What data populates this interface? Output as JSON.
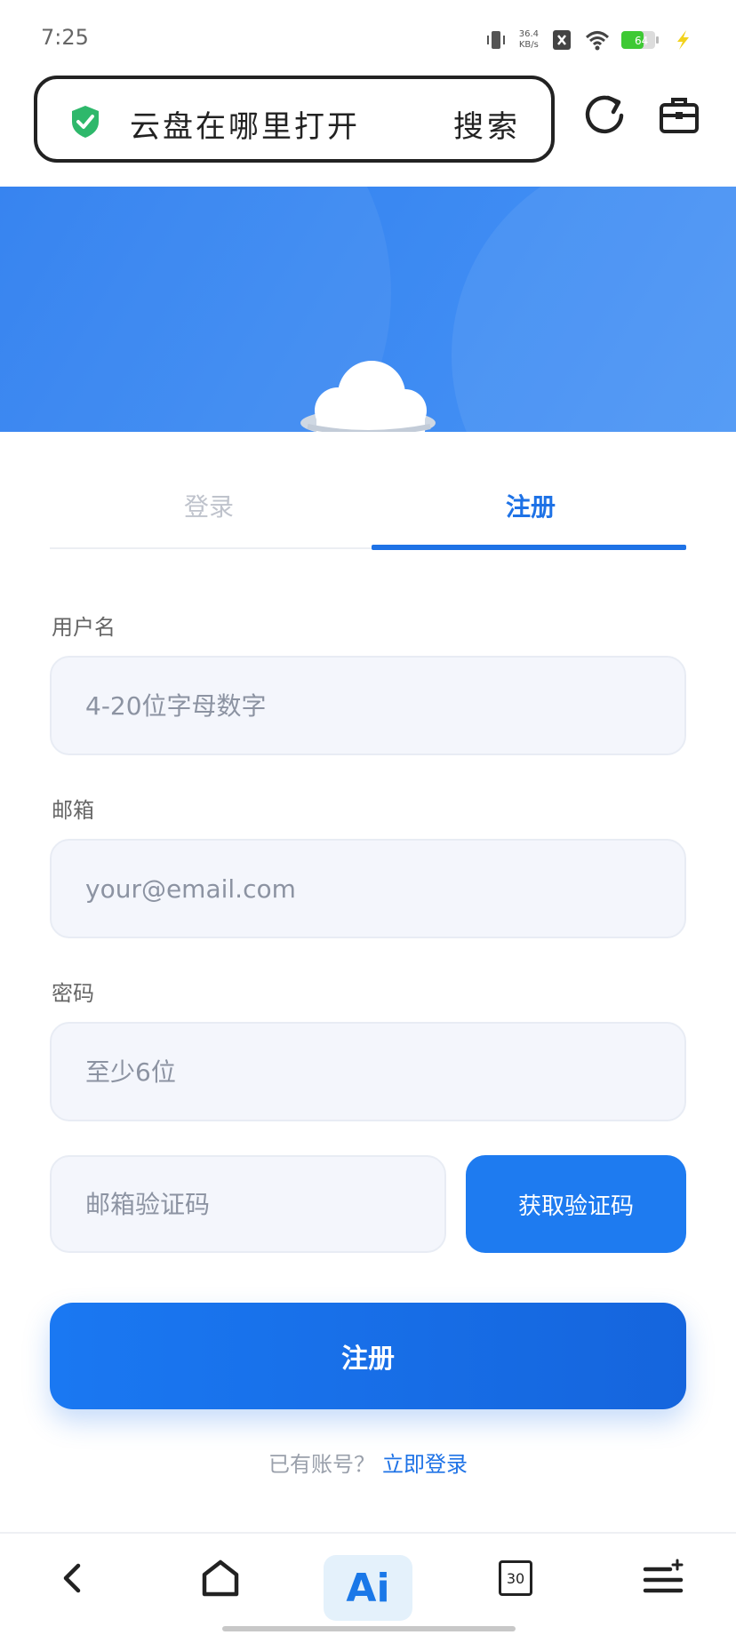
{
  "status_bar": {
    "time": "7:25",
    "net_speed_value": "36.4",
    "net_speed_unit": "KB/s",
    "battery": "64"
  },
  "browser": {
    "url_text": "云盘在哪里打开",
    "search_label": "搜索"
  },
  "tabs": {
    "login": "登录",
    "register": "注册",
    "active": "register"
  },
  "form": {
    "username": {
      "label": "用户名",
      "value": "",
      "placeholder": "4-20位字母数字"
    },
    "email": {
      "label": "邮箱",
      "value": "",
      "placeholder": "your@email.com"
    },
    "password": {
      "label": "密码",
      "value": "",
      "placeholder": "至少6位"
    },
    "code": {
      "value": "",
      "placeholder": "邮箱验证码"
    },
    "get_code_button": "获取验证码",
    "submit_button": "注册",
    "has_account_text": "已有账号？",
    "login_link": "立即登录"
  },
  "bottom_nav": {
    "ai_label": "Ai",
    "tab_count": "30"
  },
  "colors": {
    "accent": "#1e72e6",
    "banner": "#3a88f2",
    "input_bg": "#f4f6fc",
    "shield": "#2eb86b"
  },
  "icons": [
    "vibrate-icon",
    "close-box-icon",
    "wifi-icon",
    "battery-icon",
    "charging-icon",
    "shield-check-icon",
    "reload-icon",
    "toolbox-icon",
    "cloud-icon",
    "back-arrow-icon",
    "home-icon",
    "ai-icon",
    "tab-count-icon",
    "menu-icon"
  ]
}
